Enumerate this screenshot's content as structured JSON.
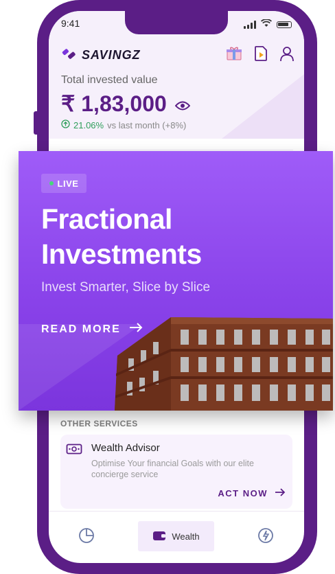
{
  "status_bar": {
    "time": "9:41"
  },
  "brand": {
    "name": "SAVINGZ"
  },
  "header_icons": [
    "gift-icon",
    "video-icon",
    "user-icon"
  ],
  "portfolio": {
    "label": "Total invested value",
    "value": "₹ 1,83,000",
    "change_pct": "21.06%",
    "change_text": "vs last month (+8%)"
  },
  "promo": {
    "badge": "LIVE",
    "title": "Fractional Investments",
    "subtitle": "Invest Smarter, Slice by Slice",
    "cta": "READ MORE"
  },
  "services": {
    "section_label": "OTHER SERVICES",
    "items": [
      {
        "title": "Wealth Advisor",
        "description": "Optimise Your financial Goals with our elite concierge service",
        "cta": "ACT NOW",
        "icon": "money-icon"
      }
    ]
  },
  "bottom_nav": {
    "items": [
      {
        "icon": "pie-chart-icon",
        "label": ""
      },
      {
        "icon": "wallet-icon",
        "label": "Wealth",
        "active": true
      },
      {
        "icon": "spark-icon",
        "label": ""
      }
    ]
  },
  "colors": {
    "primary": "#5b1e86",
    "card_gradient_top": "#9f5cf8",
    "card_gradient_bottom": "#7b35dd",
    "positive": "#2e9e5a"
  }
}
